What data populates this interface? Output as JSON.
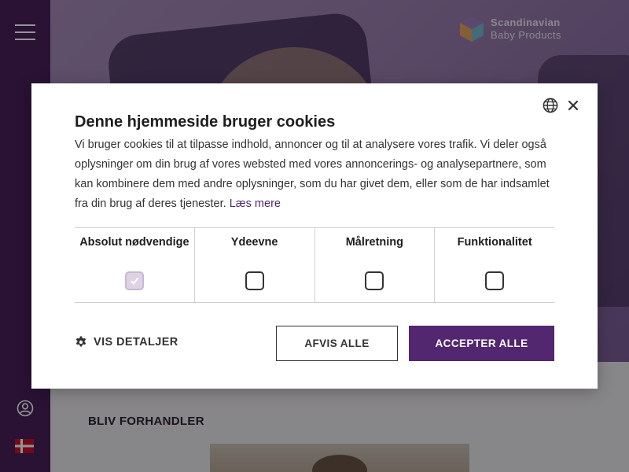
{
  "site": {
    "logo": {
      "line1": "Scandinavian",
      "line2": "Baby Products"
    },
    "section_title": "BLIV FORHANDLER",
    "colors": {
      "brand": "#47205a",
      "accent": "#52276f"
    }
  },
  "nav": {
    "menu_icon": "hamburger-icon",
    "user_icon": "user-icon",
    "language_flag": "danish-flag"
  },
  "cookie_dialog": {
    "title": "Denne hjemmeside bruger cookies",
    "body": "Vi bruger cookies til at tilpasse indhold, annoncer og til at analysere vores trafik. Vi deler også oplysninger om din brug af vores websted med vores annoncerings- og analysepartnere, som kan kombinere dem med andre oplysninger, som du har givet dem, eller som de har indsamlet fra din brug af deres tjenester.",
    "read_more": "Læs mere",
    "categories": [
      {
        "label": "Absolut nødvendige",
        "checked": true,
        "disabled": true
      },
      {
        "label": "Ydeevne",
        "checked": false,
        "disabled": false
      },
      {
        "label": "Målretning",
        "checked": false,
        "disabled": false
      },
      {
        "label": "Funktionalitet",
        "checked": false,
        "disabled": false
      }
    ],
    "details_label": "VIS DETALJER",
    "reject_label": "AFVIS ALLE",
    "accept_label": "ACCEPTER ALLE"
  }
}
